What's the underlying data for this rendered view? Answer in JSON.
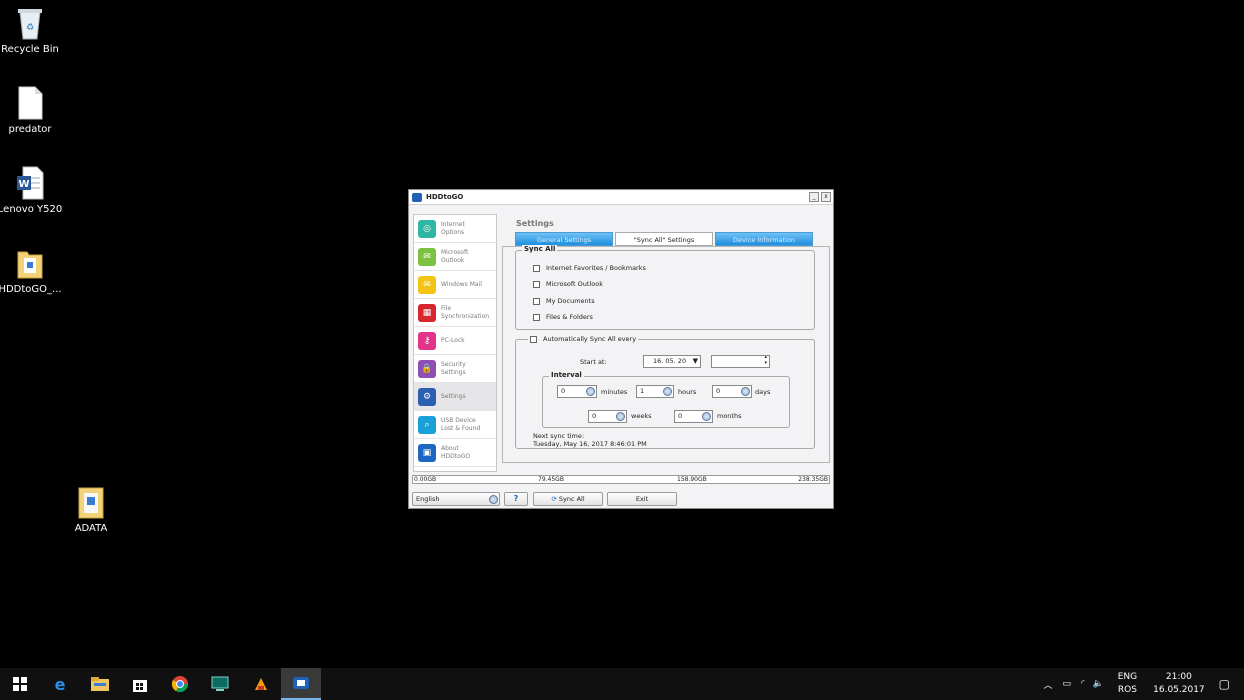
{
  "desktop": {
    "icons": [
      {
        "label": "Recycle Bin"
      },
      {
        "label": "predator"
      },
      {
        "label": "Lenovo Y520"
      },
      {
        "label": "HDDtoGO_..."
      },
      {
        "label": "ADATA"
      }
    ]
  },
  "window": {
    "title": "HDDtoGO",
    "minimize": "_",
    "close": "x",
    "heading": "Settings",
    "tabs": [
      "General Settings",
      "\"Sync All\" Settings",
      "Device Information"
    ],
    "sidebar": [
      {
        "label": "Internet\nOptions",
        "icon": "globe-icon",
        "color": "#2fb7a4",
        "glyph": "◎"
      },
      {
        "label": "Microsoft\nOutlook",
        "icon": "outlook-icon",
        "color": "#7cc142",
        "glyph": "✉"
      },
      {
        "label": "Windows Mail",
        "icon": "mail-icon",
        "color": "#f3c316",
        "glyph": "✉"
      },
      {
        "label": "File\nSynchronization",
        "icon": "file-sync-icon",
        "color": "#d7262e",
        "glyph": "▦"
      },
      {
        "label": "PC-Lock",
        "icon": "key-icon",
        "color": "#e2358a",
        "glyph": "⚷"
      },
      {
        "label": "Security\nSettings",
        "icon": "lock-icon",
        "color": "#8d4fb3",
        "glyph": "🔒"
      },
      {
        "label": "Settings",
        "icon": "gear-icon",
        "color": "#2d5fb0",
        "glyph": "⚙"
      },
      {
        "label": "USB Device\nLost & Found",
        "icon": "search-icon",
        "color": "#1aa0d8",
        "glyph": "⌕"
      },
      {
        "label": "About\nHDDtoGO",
        "icon": "about-icon",
        "color": "#1d67c2",
        "glyph": "▣"
      }
    ],
    "sync_all": {
      "title": "Sync All",
      "items": [
        "Internet Favorites / Bookmarks",
        "Microsoft Outlook",
        "My Documents",
        "Files & Folders"
      ]
    },
    "auto": {
      "label": "Automatically Sync All every",
      "start_label": "Start at:",
      "date_value": "16. 05. 20",
      "interval_title": "Interval",
      "minutes_value": "0",
      "minutes_label": "minutes",
      "hours_value": "1",
      "hours_label": "hours",
      "days_value": "0",
      "days_label": "days",
      "weeks_value": "0",
      "weeks_label": "weeks",
      "months_value": "0",
      "months_label": "months",
      "next_label": "Next sync time:",
      "next_value": "Tuesday, May 16, 2017 8:46:01 PM"
    },
    "status": [
      "0.00GB",
      "79.45GB",
      "158.90GB",
      "238.35GB"
    ],
    "language": "English",
    "help": "?",
    "sync_button": "Sync All",
    "exit_button": "Exit"
  },
  "taskbar": {
    "lang_top": "ENG",
    "lang_bottom": "ROS",
    "time": "21:00",
    "date": "16.05.2017"
  }
}
